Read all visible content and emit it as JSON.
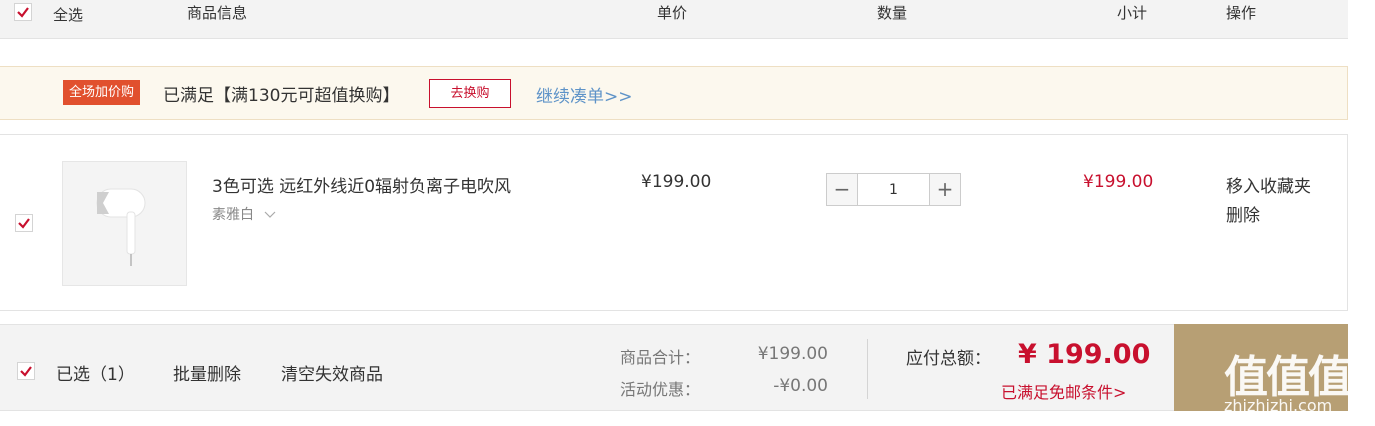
{
  "header": {
    "select_all": "全选",
    "col_info": "商品信息",
    "col_price": "单价",
    "col_qty": "数量",
    "col_subtotal": "小计",
    "col_action": "操作"
  },
  "promo": {
    "tag": "全场加价购",
    "text": "已满足【满130元可超值换购】",
    "button": "去换购",
    "link": "继续凑单>>"
  },
  "item": {
    "title": "3色可选 远红外线近0辐射负离子电吹风",
    "variant": "素雅白",
    "unit_price": "¥199.00",
    "quantity": "1",
    "minus": "−",
    "plus": "+",
    "subtotal": "¥199.00",
    "move_to_favorites": "移入收藏夹",
    "delete": "删除"
  },
  "footer": {
    "selected": "已选（1）",
    "batch_delete": "批量删除",
    "clear_invalid": "清空失效商品",
    "goods_total_label": "商品合计：",
    "goods_total_value": "¥199.00",
    "discount_label": "活动优惠：",
    "discount_value": "-¥0.00",
    "pay_label": "应付总额：",
    "pay_value": "¥ 199.00",
    "shipping": "已满足免邮条件>"
  },
  "watermark": {
    "mark": "值值值",
    "url": "zhizhizhi.com"
  },
  "colors": {
    "accent_red": "#c8102e",
    "promo_tag": "#e1502e",
    "link_blue": "#5e93c8",
    "checkout_gold": "#b79f74"
  }
}
